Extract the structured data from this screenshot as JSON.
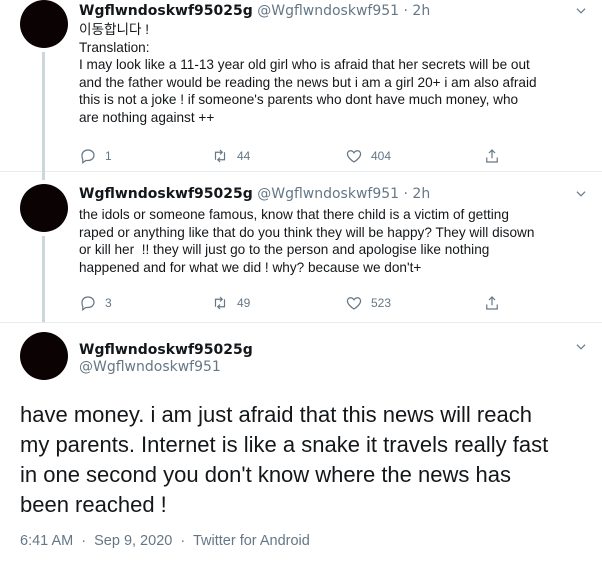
{
  "thread": [
    {
      "author": {
        "display_name": "Wgflwndoskwf95025g",
        "handle": "@Wgflwndoskwf951",
        "time": "2h"
      },
      "separator": "·",
      "text_lines": [
        "이동합니다 !",
        "Translation:",
        "I may look like a 11-13 year old girl who is afraid that her secrets will be out",
        "and the father would be reading the news but i am a girl 20+ i am also afraid",
        "this is not a joke ! if someone's parents who dont have much money, who",
        "are nothing against ++"
      ],
      "stats": {
        "replies": "1",
        "retweets": "44",
        "likes": "404"
      }
    },
    {
      "author": {
        "display_name": "Wgflwndoskwf95025g",
        "handle": "@Wgflwndoskwf951",
        "time": "2h"
      },
      "separator": "·",
      "text_lines": [
        "the idols or someone famous, know that there child is a victim of getting",
        "raped or anything like that do you think they will be happy? They will disown",
        "or kill her  !! they will just go to the person and apologise like nothing",
        "happened and for what we did ! why? because we don't+"
      ],
      "stats": {
        "replies": "3",
        "retweets": "49",
        "likes": "523"
      }
    }
  ],
  "main_tweet": {
    "author": {
      "display_name": "Wgflwndoskwf95025g",
      "handle": "@Wgflwndoskwf951"
    },
    "text_lines": [
      "have money. i am just afraid that this news will reach",
      "my parents. Internet is like a snake it travels really fast",
      "in one second you don't know where the news has",
      "been reached !"
    ],
    "meta": {
      "time": "6:41 AM",
      "date": "Sep 9, 2020",
      "source": "Twitter for Android",
      "separator": "·"
    }
  },
  "icons": {
    "reply": "reply-icon",
    "retweet": "retweet-icon",
    "like": "heart-icon",
    "share": "share-icon",
    "menu": "chevron-down-icon"
  },
  "colors": {
    "text": "#14171a",
    "secondary": "#657786",
    "divider": "#e6ecf0",
    "avatar": "#0a0203"
  }
}
